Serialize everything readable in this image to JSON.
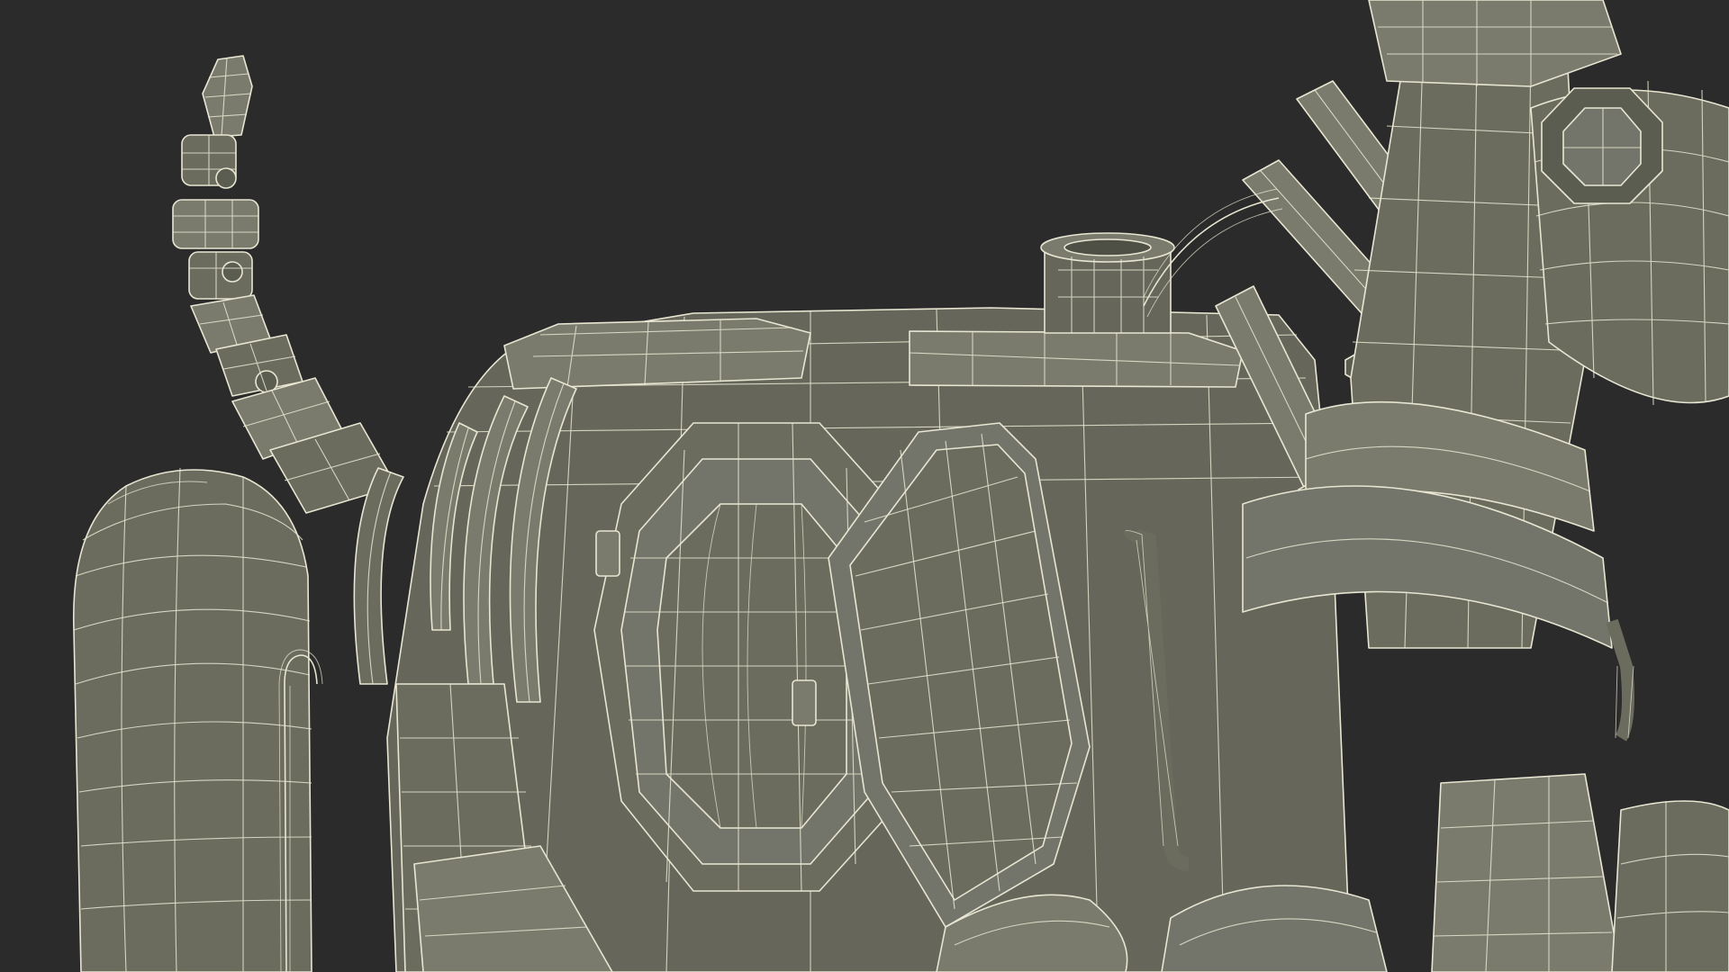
{
  "scene": {
    "background_color": "#2b2b2b",
    "mesh_fill_color": "#6b6c5e",
    "mesh_fill_dark": "#5c5d51",
    "mesh_fill_light": "#7a7b6c",
    "wire_color": "#e8e6d2"
  }
}
